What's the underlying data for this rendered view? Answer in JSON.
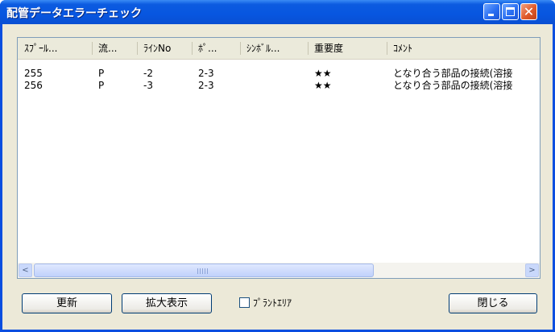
{
  "window": {
    "title": "配管データエラーチェック",
    "controls": {
      "minimize_icon": "minimize-icon",
      "maximize_icon": "maximize-icon",
      "close_glyph": "✕"
    }
  },
  "list": {
    "columns": [
      "ｽﾌﾟｰﾙ...",
      "流...",
      "ﾗｲﾝNo",
      "ﾎﾟ...",
      "ｼﾝﾎﾞﾙ...",
      "重要度",
      "ｺﾒﾝﾄ"
    ],
    "rows": [
      [
        "255",
        "P",
        "-2",
        "2-3",
        "",
        "★★",
        "となり合う部品の接続(溶接"
      ],
      [
        "256",
        "P",
        "-3",
        "2-3",
        "",
        "★★",
        "となり合う部品の接続(溶接"
      ]
    ]
  },
  "scrollbar": {
    "left_glyph": "<",
    "right_glyph": ">"
  },
  "buttons": {
    "refresh": "更新",
    "zoom": "拡大表示",
    "close": "閉じる"
  },
  "checkbox": {
    "label": "ﾌﾟﾗﾝﾄｴﾘｱ",
    "checked": false
  }
}
